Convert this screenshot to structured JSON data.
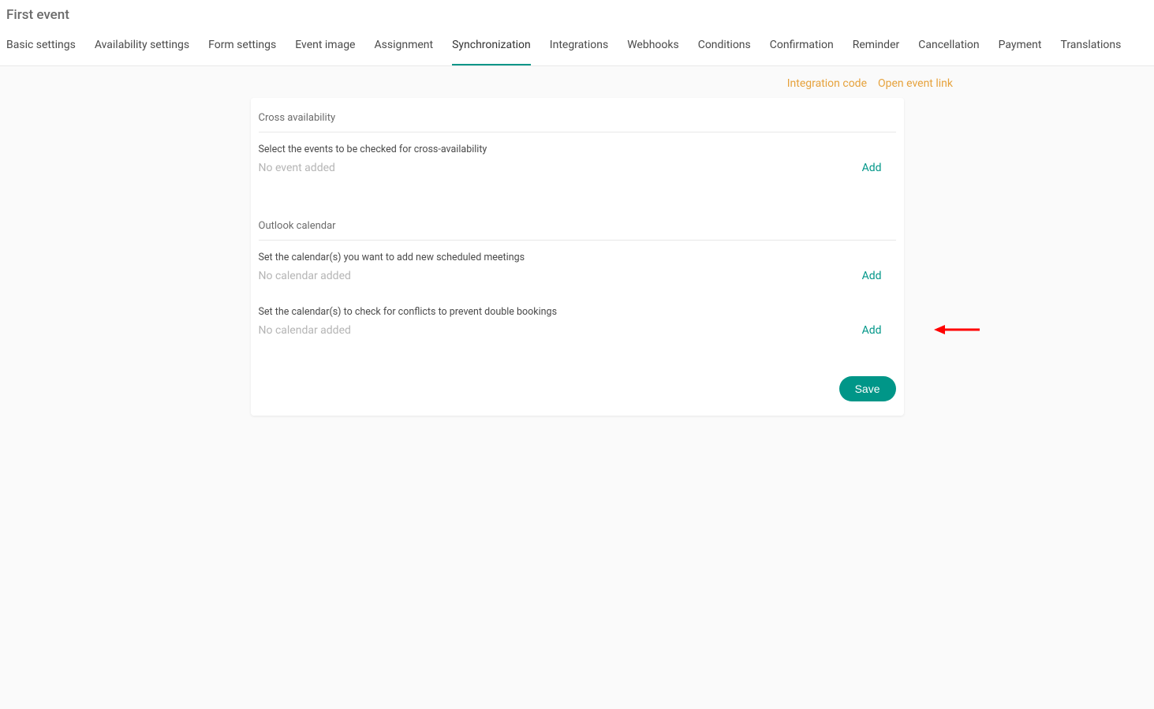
{
  "page_title": "First event",
  "tabs": [
    {
      "label": "Basic settings",
      "active": false
    },
    {
      "label": "Availability settings",
      "active": false
    },
    {
      "label": "Form settings",
      "active": false
    },
    {
      "label": "Event image",
      "active": false
    },
    {
      "label": "Assignment",
      "active": false
    },
    {
      "label": "Synchronization",
      "active": true
    },
    {
      "label": "Integrations",
      "active": false
    },
    {
      "label": "Webhooks",
      "active": false
    },
    {
      "label": "Conditions",
      "active": false
    },
    {
      "label": "Confirmation",
      "active": false
    },
    {
      "label": "Reminder",
      "active": false
    },
    {
      "label": "Cancellation",
      "active": false
    },
    {
      "label": "Payment",
      "active": false
    },
    {
      "label": "Translations",
      "active": false
    }
  ],
  "links": {
    "integration_code": "Integration code",
    "open_event_link": "Open event link"
  },
  "cross_availability": {
    "title": "Cross availability",
    "instruction": "Select the events to be checked for cross-availability",
    "placeholder": "No event added",
    "add_label": "Add"
  },
  "outlook": {
    "title": "Outlook calendar",
    "add_instruction": "Set the calendar(s) you want to add new scheduled meetings",
    "add_placeholder": "No calendar added",
    "add_label": "Add",
    "conflict_instruction": "Set the calendar(s) to check for conflicts to prevent double bookings",
    "conflict_placeholder": "No calendar added",
    "conflict_add_label": "Add"
  },
  "save_label": "Save"
}
